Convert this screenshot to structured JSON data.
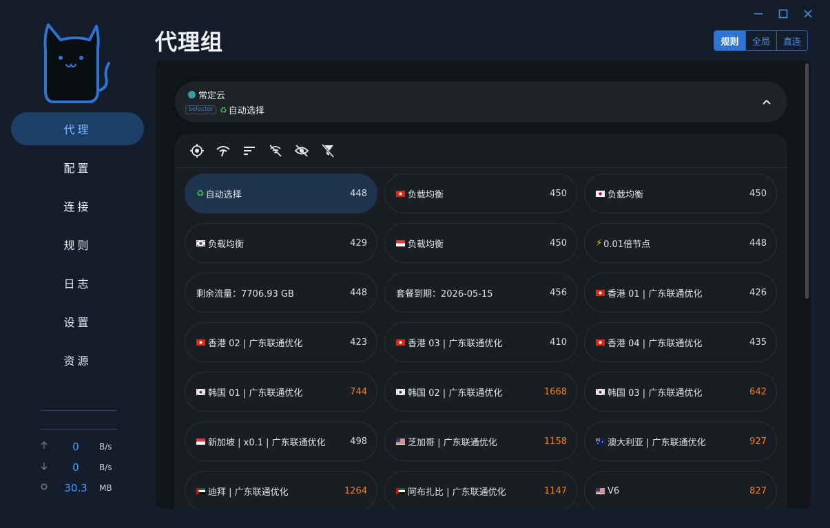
{
  "window": {
    "minimize": "–",
    "maximize": "☐",
    "close": "✕"
  },
  "nav": [
    {
      "label": "代理",
      "active": true
    },
    {
      "label": "配置"
    },
    {
      "label": "连接"
    },
    {
      "label": "规则"
    },
    {
      "label": "日志"
    },
    {
      "label": "设置"
    },
    {
      "label": "资源"
    }
  ],
  "stats": {
    "up": {
      "value": "0",
      "unit": "B/s"
    },
    "down": {
      "value": "0",
      "unit": "B/s"
    },
    "memory": {
      "value": "30.3",
      "unit": "MB"
    }
  },
  "page": {
    "title": "代理组"
  },
  "modes": [
    {
      "label": "规则",
      "active": true
    },
    {
      "label": "全局"
    },
    {
      "label": "直连"
    }
  ],
  "group": {
    "name": "常定云",
    "type": "Selector",
    "selected": "自动选择"
  },
  "toolbar_icons": [
    "locate-icon",
    "delay-test-icon",
    "sort-icon",
    "hide-unavailable-icon",
    "hide-icon",
    "filter-off-icon"
  ],
  "nodes": [
    {
      "name": "自动选择",
      "delay": "448",
      "flag": "recycle",
      "active": true
    },
    {
      "name": "负载均衡",
      "delay": "450",
      "flag": "hk"
    },
    {
      "name": "负载均衡",
      "delay": "450",
      "flag": "jp"
    },
    {
      "name": "负载均衡",
      "delay": "429",
      "flag": "kr"
    },
    {
      "name": "负载均衡",
      "delay": "450",
      "flag": "sg"
    },
    {
      "name": "0.01倍节点",
      "delay": "448",
      "flag": "bolt"
    },
    {
      "name": "剩余流量：7706.93 GB",
      "delay": "448",
      "flag": ""
    },
    {
      "name": "套餐到期：2026-05-15",
      "delay": "456",
      "flag": ""
    },
    {
      "name": "香港 01 | 广东联通优化",
      "delay": "426",
      "flag": "hk"
    },
    {
      "name": "香港 02 | 广东联通优化",
      "delay": "423",
      "flag": "hk"
    },
    {
      "name": "香港 03 | 广东联通优化",
      "delay": "410",
      "flag": "hk"
    },
    {
      "name": "香港 04 | 广东联通优化",
      "delay": "435",
      "flag": "hk"
    },
    {
      "name": "韩国 01 | 广东联通优化",
      "delay": "744",
      "flag": "kr",
      "slow": true
    },
    {
      "name": "韩国 02 | 广东联通优化",
      "delay": "1668",
      "flag": "kr",
      "slow": true
    },
    {
      "name": "韩国 03 | 广东联通优化",
      "delay": "642",
      "flag": "kr",
      "slow": true
    },
    {
      "name": "新加坡 | x0.1 | 广东联通优化",
      "delay": "498",
      "flag": "sg"
    },
    {
      "name": "芝加哥 | 广东联通优化",
      "delay": "1158",
      "flag": "us",
      "slow": true
    },
    {
      "name": "澳大利亚 | 广东联通优化",
      "delay": "927",
      "flag": "au",
      "slow": true
    },
    {
      "name": "迪拜 | 广东联通优化",
      "delay": "1264",
      "flag": "ae",
      "slow": true
    },
    {
      "name": "阿布扎比 | 广东联通优化",
      "delay": "1147",
      "flag": "ae",
      "slow": true
    },
    {
      "name": "V6",
      "delay": "827",
      "flag": "us",
      "slow": true
    }
  ],
  "colors": {
    "accent": "#2f74d0",
    "slow_delay": "#e8822a",
    "normal_delay": "#d8dbe0"
  }
}
